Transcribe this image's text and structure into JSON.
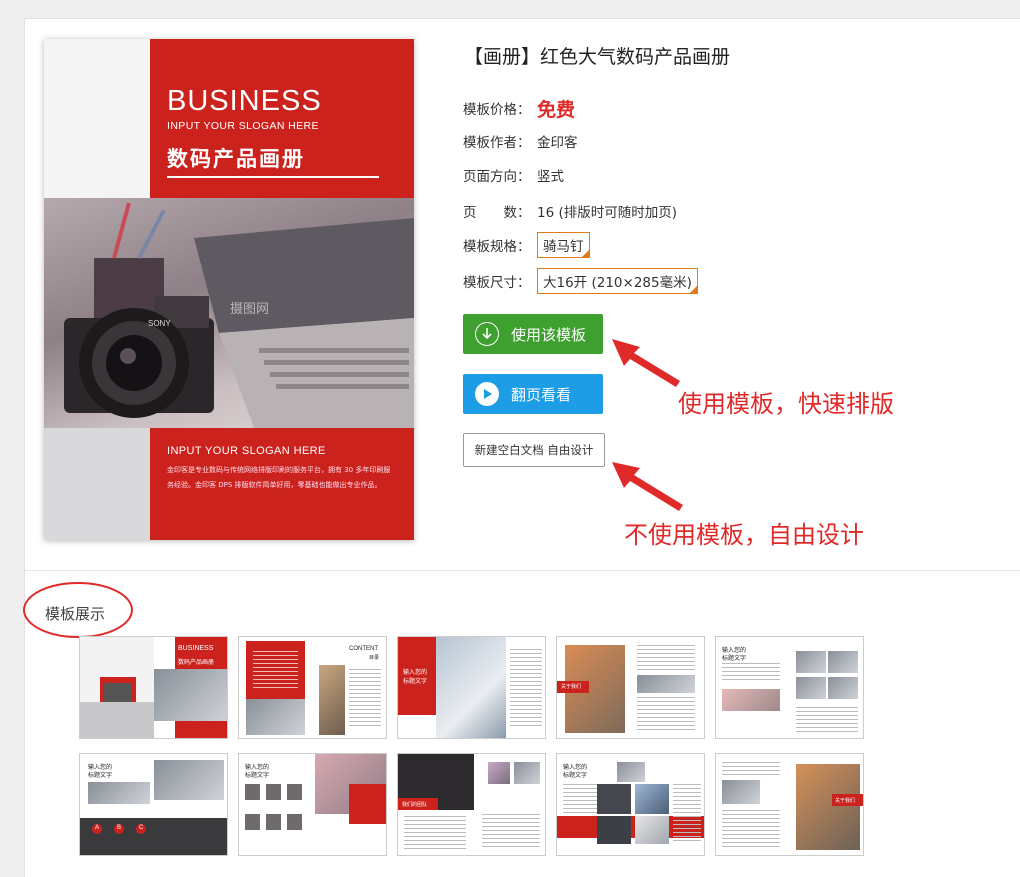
{
  "cover": {
    "title": "BUSINESS",
    "slogan": "INPUT YOUR SLOGAN HERE",
    "title_cn": "数码产品画册",
    "slogan_bottom": "INPUT YOUR SLOGAN HERE",
    "description": "金印客是专业数码与传统网络排版印刷的服务平台，拥有 30 多年印刷服务经验。金印客 DPS 排版软件简单好用，零基础也能做出专业作品。",
    "watermark": "摄图网",
    "camera_brand": "SONY"
  },
  "product": {
    "title": "【画册】红色大气数码产品画册",
    "price_label": "模板价格：",
    "price_value": "免费",
    "author_label": "模板作者：",
    "author_value": "金印客",
    "orientation_label": "页面方向：",
    "orientation_value": "竖式",
    "pages_label": "页　　数：",
    "pages_value": "16 (排版时可随时加页)",
    "spec_label": "模板规格：",
    "spec_value": "骑马钉",
    "size_label": "模板尺寸：",
    "size_value": "大16开 (210×285毫米)"
  },
  "buttons": {
    "use_template": "使用该模板",
    "flip_view": "翻页看看",
    "new_blank": "新建空白文档 自由设计"
  },
  "annotations": {
    "use_template_note": "使用模板，快速排版",
    "no_template_note": "不使用模板，自由设计"
  },
  "section": {
    "showcase_label": "模板展示"
  },
  "thumbs": {
    "t1_title": "BUSINESS",
    "t1_sub": "数码产品画册",
    "t2_content": "CONTENT",
    "t2_sub": "目录",
    "t3_title": "输入您的",
    "t3_sub": "标题文字",
    "t4_tag": "关于我们",
    "t5_title": "输入您的",
    "t5_sub": "标题文字",
    "t6_title": "输入您的",
    "t6_sub": "标题文字",
    "t6_steps": [
      "A",
      "B",
      "C"
    ],
    "t7_title": "输入您的",
    "t7_sub": "标题文字",
    "t8_tag": "我们的团队",
    "t9_title": "输入您的",
    "t9_sub": "标题文字",
    "t10_tag": "关于我们"
  },
  "colors": {
    "brand_red": "#cc221d",
    "use_green": "#3ea12f",
    "flip_blue": "#1d9de5",
    "annotation_red": "#e02a2a",
    "tag_orange": "#e07a1b"
  }
}
